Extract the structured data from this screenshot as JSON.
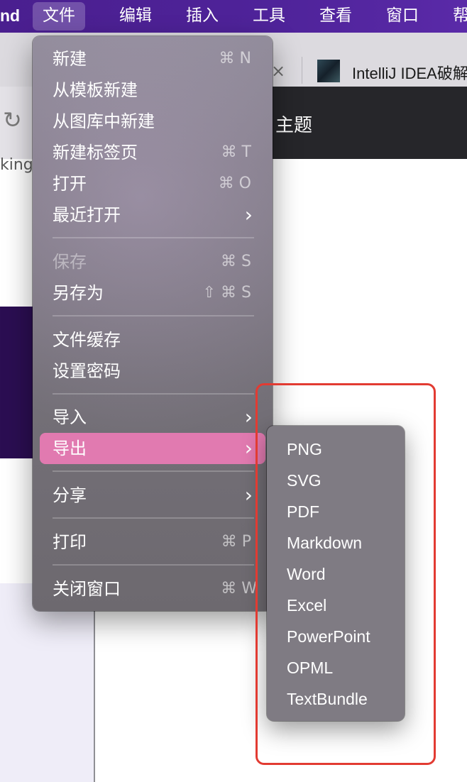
{
  "menubar": {
    "app_fragment": "nd",
    "items": [
      "文件",
      "编辑",
      "插入",
      "工具",
      "查看",
      "窗口",
      "帮"
    ]
  },
  "browser": {
    "tab_close": "×",
    "tab_title": "IntelliJ IDEA破解",
    "url_fragment": "king",
    "dark_title": "主题"
  },
  "file_menu": {
    "items": [
      {
        "label": "新建",
        "shortcut": "⌘ N"
      },
      {
        "label": "从模板新建"
      },
      {
        "label": "从图库中新建"
      },
      {
        "label": "新建标签页",
        "shortcut": "⌘ T"
      },
      {
        "label": "打开",
        "shortcut": "⌘ O"
      },
      {
        "label": "最近打开",
        "arrow": "›"
      },
      {
        "label": "保存",
        "shortcut": "⌘ S",
        "disabled": true
      },
      {
        "label": "另存为",
        "shortcut": "⇧ ⌘ S"
      },
      {
        "label": "文件缓存"
      },
      {
        "label": "设置密码"
      },
      {
        "label": "导入",
        "arrow": "›"
      },
      {
        "label": "导出",
        "arrow": "›",
        "highlighted": true
      },
      {
        "label": "分享",
        "arrow": "›"
      },
      {
        "label": "打印",
        "shortcut": "⌘ P"
      },
      {
        "label": "关闭窗口",
        "shortcut": "⌘ W"
      }
    ]
  },
  "export_submenu": {
    "items": [
      "PNG",
      "SVG",
      "PDF",
      "Markdown",
      "Word",
      "Excel",
      "PowerPoint",
      "OPML",
      "TextBundle"
    ]
  },
  "colors": {
    "menubar": "#4f239a",
    "highlight": "#e17ab0",
    "annotation": "#e23b32"
  }
}
